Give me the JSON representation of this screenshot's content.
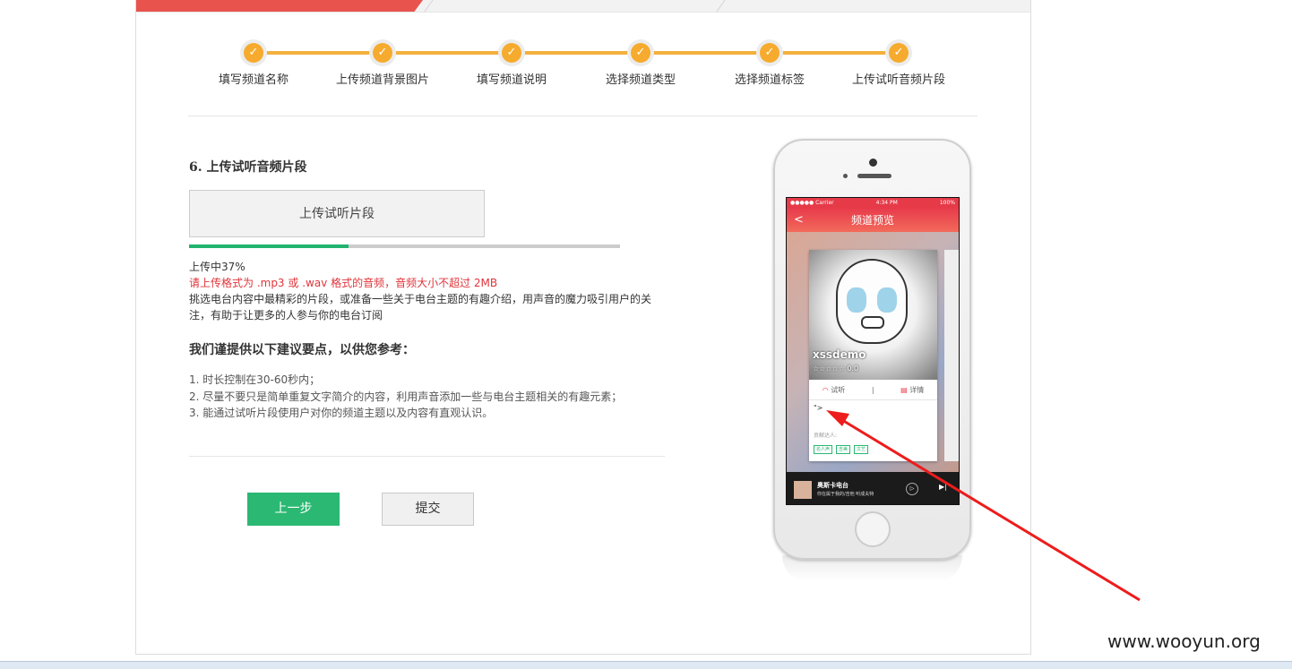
{
  "steps": [
    {
      "label": "填写频道名称",
      "done": true
    },
    {
      "label": "上传频道背景图片",
      "done": true
    },
    {
      "label": "填写频道说明",
      "done": true
    },
    {
      "label": "选择频道类型",
      "done": true
    },
    {
      "label": "选择频道标签",
      "done": true
    },
    {
      "label": "上传试听音频片段",
      "done": true
    }
  ],
  "step_check_glyph": "✓",
  "section_title": "6. 上传试听音频片段",
  "upload_button_label": "上传试听片段",
  "upload": {
    "progress": 0.37,
    "status_text": "上传中37%",
    "format_warning": "请上传格式为 .mp3 或 .wav 格式的音频，音频大小不超过 2MB",
    "description": "挑选电台内容中最精彩的片段，或准备一些关于电台主题的有趣介绍，用声音的魔力吸引用户的关注，有助于让更多的人参与你的电台订阅"
  },
  "suggestions_title": "我们谨提供以下建议要点，以供您参考：",
  "suggestions": [
    "1. 时长控制在30-60秒内；",
    "2. 尽量不要只是简单重复文字简介的内容，利用声音添加一些与电台主题相关的有趣元素；",
    "3. 能通过试听片段使用户对你的频道主题以及内容有直观认识。"
  ],
  "prev_button_label": "上一步",
  "submit_button_label": "提交",
  "phone_preview": {
    "status_carrier": "●●●●● Carrier",
    "status_time": "4:34 PM",
    "status_battery": "100%",
    "nav_title": "频道预览",
    "back_glyph": "<",
    "channel_name": "xssdemo",
    "rating_text": "☆☆☆☆☆ 0.0",
    "action_listen": "试听",
    "action_detail": "详情",
    "xss_text": "\">",
    "contributors_label": "贡献达人:",
    "tags": [
      "名人声",
      "吉美",
      "文艺"
    ],
    "player_title": "奥斯卡电台",
    "player_subtitle": "你在属于我的/吉他  听成夫特",
    "play_glyph": "▷",
    "next_glyph": "▶|"
  },
  "colors": {
    "accent_red": "#e8534e",
    "step_orange": "#f6ab2e",
    "green": "#2bb873",
    "warning_red": "#e0353b",
    "annotation_arrow": "#ee1c1c"
  },
  "watermark": "www.wooyun.org"
}
